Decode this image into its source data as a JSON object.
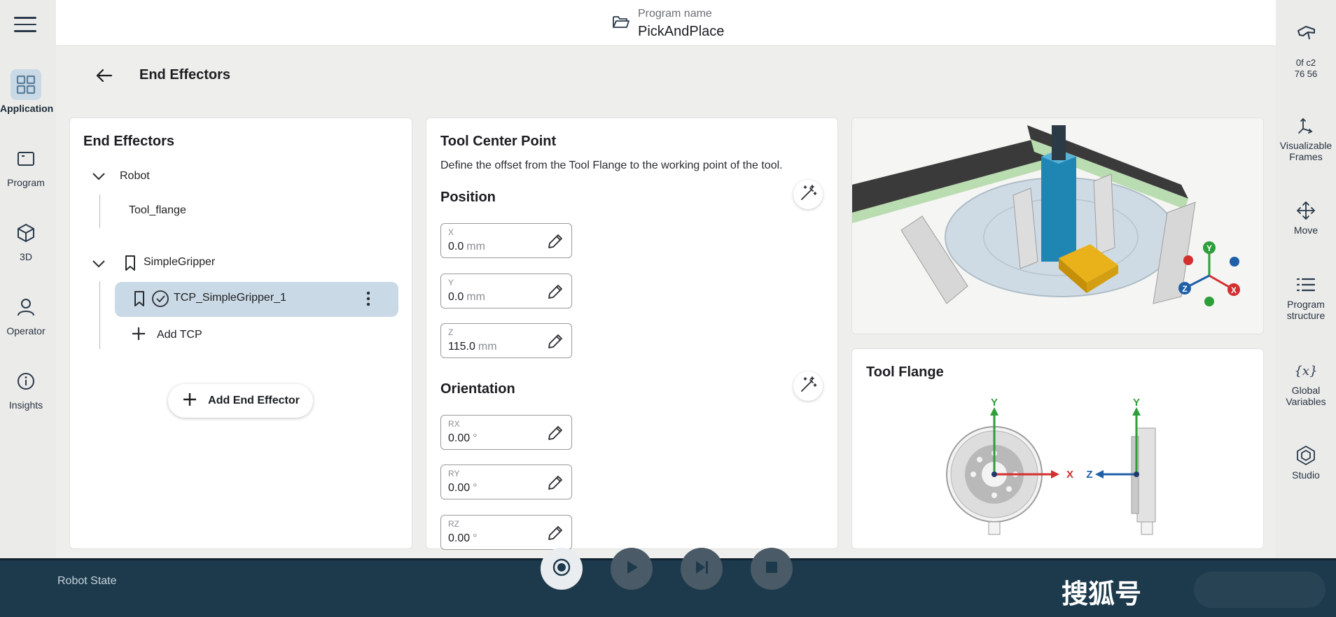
{
  "header": {
    "program_label": "Program name",
    "program_name": "PickAndPlace"
  },
  "page": {
    "title": "End Effectors"
  },
  "left_nav": {
    "items": [
      {
        "label": "Application",
        "icon": "grid-icon",
        "active": true
      },
      {
        "label": "Program",
        "icon": "program-icon",
        "active": false
      },
      {
        "label": "3D",
        "icon": "cube-icon",
        "active": false
      },
      {
        "label": "Operator",
        "icon": "user-icon",
        "active": false
      },
      {
        "label": "Insights",
        "icon": "info-icon",
        "active": false
      }
    ]
  },
  "right_nav": {
    "hex_line1": "0f  c2",
    "hex_line2": "76  56",
    "items": [
      {
        "label_1": "Visualizable",
        "label_2": "Frames",
        "icon": "frames-icon"
      },
      {
        "label_1": "Move",
        "label_2": "",
        "icon": "move-icon"
      },
      {
        "label_1": "Program",
        "label_2": "structure",
        "icon": "list-icon"
      },
      {
        "label_1": "Global",
        "label_2": "Variables",
        "icon": "variable-icon"
      },
      {
        "label_1": "Studio",
        "label_2": "",
        "icon": "studio-icon"
      }
    ]
  },
  "end_effectors": {
    "title": "End Effectors",
    "robot_label": "Robot",
    "tool_flange_label": "Tool_flange",
    "gripper_label": "SimpleGripper",
    "tcp_label": "TCP_SimpleGripper_1",
    "add_tcp_label": "Add TCP",
    "add_end_effector_label": "Add End Effector"
  },
  "tcp": {
    "title": "Tool Center Point",
    "description": "Define the offset from the Tool Flange to the working point of the tool.",
    "position_title": "Position",
    "orientation_title": "Orientation",
    "position": [
      {
        "label": "X",
        "value": "0.0",
        "unit": "mm"
      },
      {
        "label": "Y",
        "value": "0.0",
        "unit": "mm"
      },
      {
        "label": "Z",
        "value": "115.0",
        "unit": "mm"
      }
    ],
    "orientation": [
      {
        "label": "RX",
        "value": "0.00",
        "unit": "°"
      },
      {
        "label": "RY",
        "value": "0.00",
        "unit": "°"
      },
      {
        "label": "RZ",
        "value": "0.00",
        "unit": "°"
      }
    ]
  },
  "view3d": {
    "axis_y": "Y",
    "axis_x": "X",
    "axis_z": "Z"
  },
  "tool_flange": {
    "title": "Tool Flange",
    "axis_x": "X",
    "axis_y": "Y",
    "axis_z": "Z"
  },
  "bottom_bar": {
    "robot_state_label": "Robot State",
    "watermark": "搜狐号"
  },
  "colors": {
    "accent": "#c9d9e6",
    "bottom_bar": "#1d3a4c",
    "axis_x": "#d32f2f",
    "axis_y": "#2e9e3a",
    "axis_z": "#1f5fa8"
  }
}
